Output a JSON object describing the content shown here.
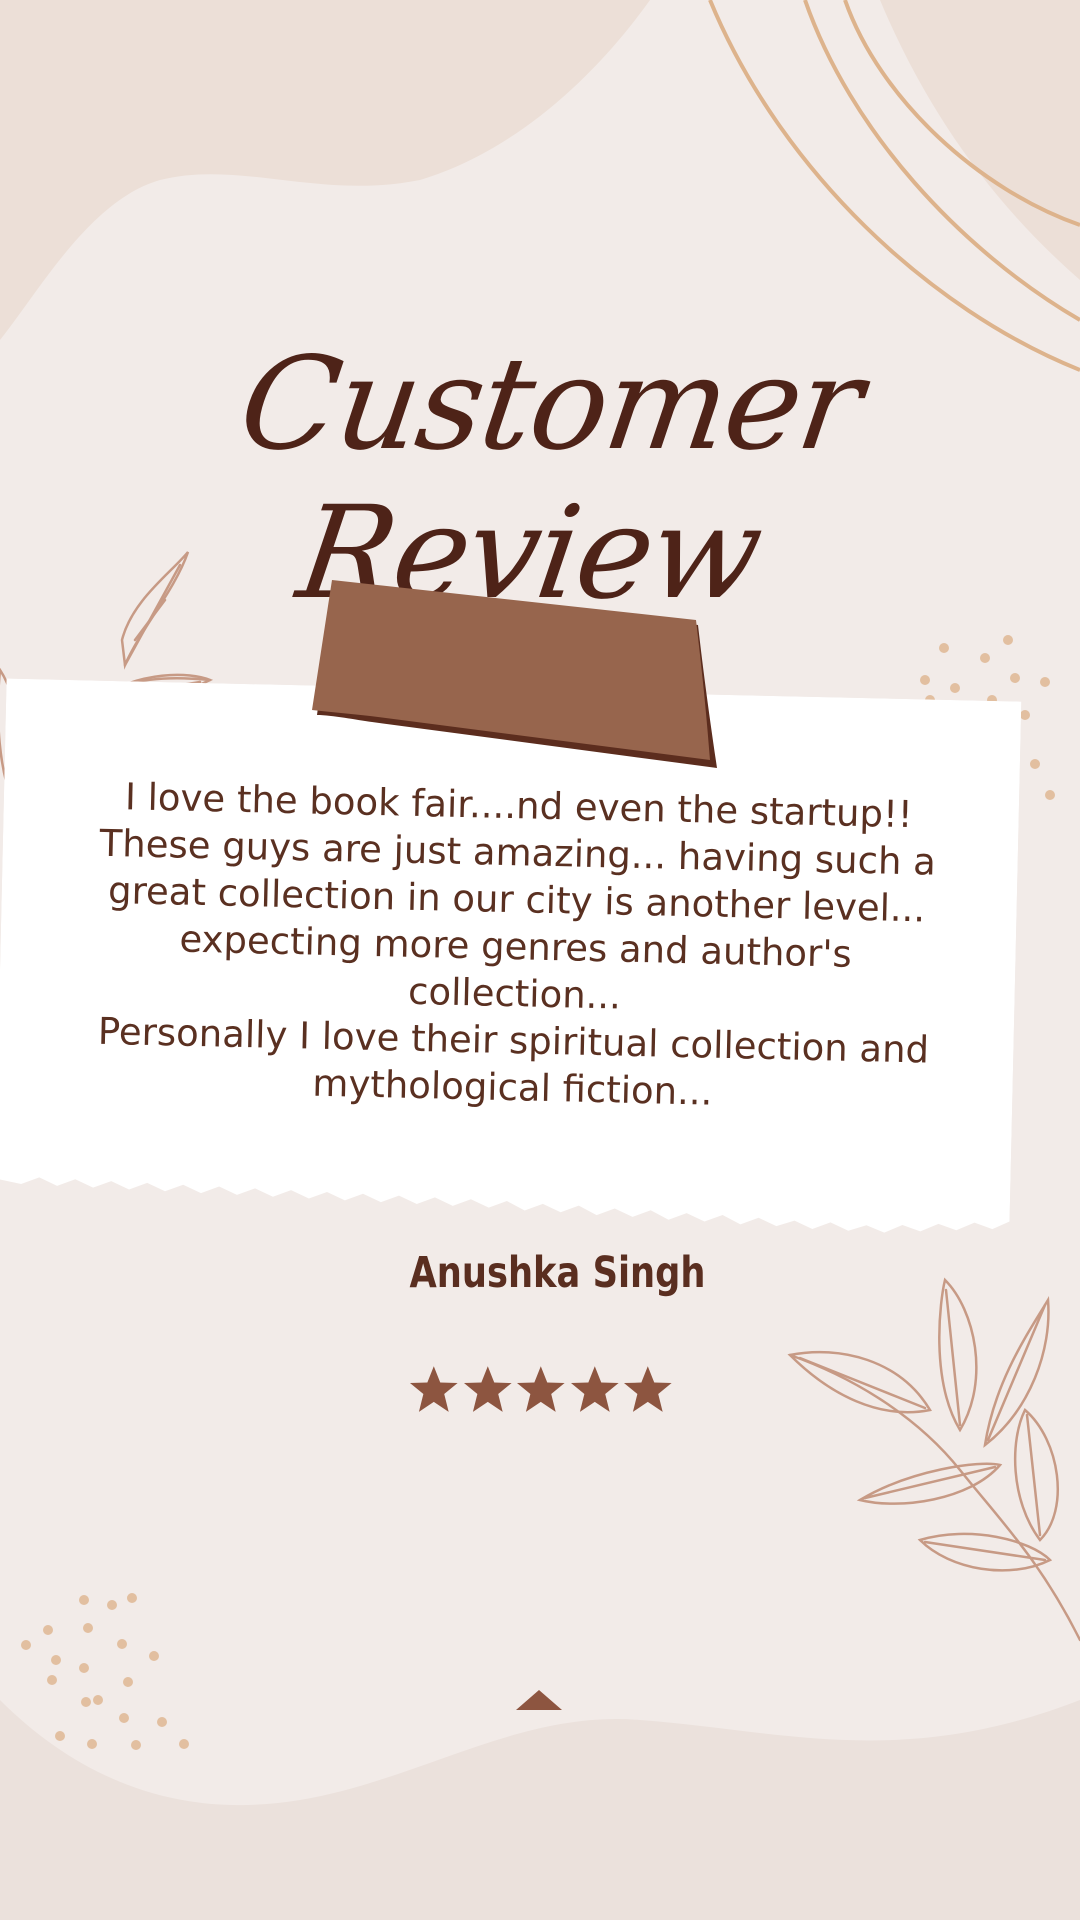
{
  "title": "Customer Review",
  "review": {
    "text": "I love the book fair....nd even the startup!!\nThese guys are just amazing... having such a great collection in our city is another level... expecting more genres and author's collection...\nPersonally I love their spiritual collection and mythological fiction..."
  },
  "reviewer": {
    "name": "Anushka Singh"
  },
  "rating": {
    "value": 5,
    "max": 5
  },
  "icons": [
    "leaf-icon",
    "star-icon",
    "tape-decoration",
    "up-arrow-icon"
  ],
  "colors": {
    "background": "#f2ebe8",
    "accent": "#97654d",
    "text_dark": "#4e2318",
    "dots": "#e2bfa0",
    "line": "#ddb38c"
  }
}
